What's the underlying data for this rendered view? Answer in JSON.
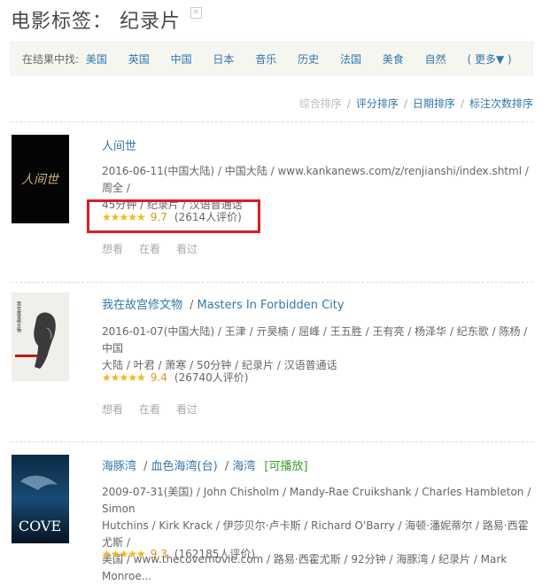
{
  "page": {
    "title_prefix": "电影标签：",
    "title_tag": "纪录片",
    "close_glyph": "×"
  },
  "filter": {
    "label": "在结果中找:",
    "items": [
      "美国",
      "英国",
      "中国",
      "日本",
      "音乐",
      "历史",
      "法国",
      "美食",
      "自然",
      "( 更多▼ )"
    ]
  },
  "sort": {
    "options": [
      "综合排序",
      "评分排序",
      "日期排序",
      "标注次数排序"
    ],
    "separator": "/"
  },
  "movies": [
    {
      "title": "人间世",
      "poster_text": "人间世",
      "meta_line1": "2016-06-11(中国大陆) / 中国大陆 / www.kankanews.com/z/renjianshi/index.shtml / 周全 /",
      "meta_line2": "45分钟 / 纪录片 / 汉语普通话",
      "stars": "★★★★★",
      "score": "9.7",
      "votes": "(2614人评价)",
      "actions": [
        "想看",
        "在看",
        "看过"
      ]
    },
    {
      "title": "我在故宫修文物",
      "title_alt": "Masters In Forbidden City",
      "title_sep": "/",
      "poster_text": "我在故宫修文物",
      "meta_line1": "2016-01-07(中国大陆) / 王津 / 亓昊楠 / 屈峰 / 王五胜 / 王有亮 / 杨泽华 / 纪东歌 / 陈杨 / 中国",
      "meta_line2": "大陆 / 叶君 / 萧寒 / 50分钟 / 纪录片 / 汉语普通话",
      "stars": "★★★★★",
      "score": "9.4",
      "votes": "(26740人评价)",
      "actions": [
        "想看",
        "在看",
        "看过"
      ]
    },
    {
      "title": "海豚湾",
      "title_alt": "血色海湾(台)",
      "title_alt2": "海湾",
      "title_sep": "/",
      "playable": "[可播放]",
      "poster_text": "COVE",
      "meta_line1": "2009-07-31(美国) / John Chisholm / Mandy-Rae Cruikshank / Charles Hambleton / Simon",
      "meta_line2": "Hutchins / Kirk Krack / 伊莎贝尔·卢卡斯 / Richard O'Barry / 海顿·潘妮蒂尔 / 路易·西霍尤斯 /",
      "meta_line3": "美国 / www.thecovemovie.com / 路易·西霍尤斯 / 92分钟 / 海豚湾 / 纪录片 / Mark Monroe...",
      "stars": "★★★★★",
      "score": "9.3",
      "votes": "(162185人评价)"
    }
  ],
  "colors": {
    "link": "#3377aa",
    "star": "#f4b619",
    "highlight_box": "#e01b22",
    "playable": "#3c9b2c"
  }
}
